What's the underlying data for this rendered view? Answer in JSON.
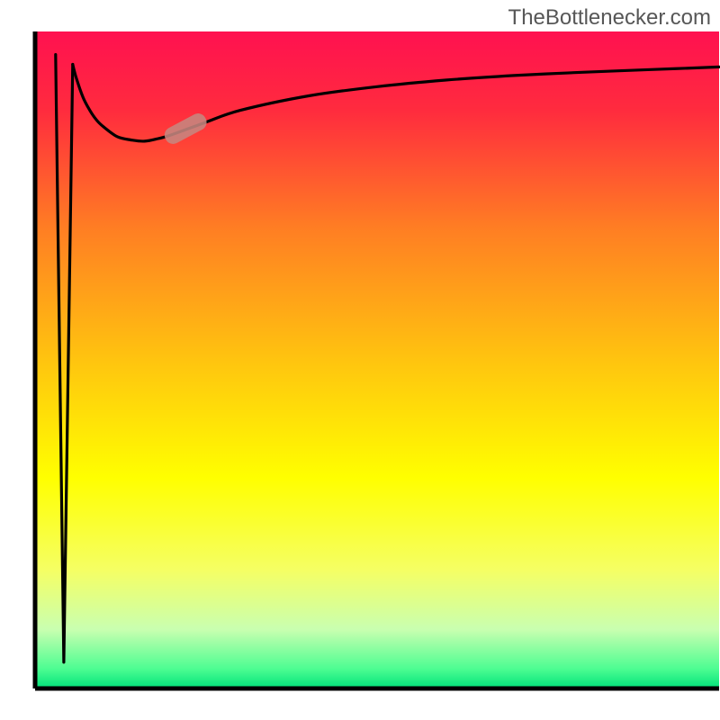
{
  "attribution": "TheBottlenecker.com",
  "chart_data": {
    "type": "line",
    "title": "",
    "xlabel": "",
    "ylabel": "",
    "xlim": [
      0,
      100
    ],
    "ylim": [
      0,
      100
    ],
    "background_gradient": {
      "stops": [
        {
          "offset": 0.0,
          "color": "#ff1150"
        },
        {
          "offset": 0.12,
          "color": "#ff2b3e"
        },
        {
          "offset": 0.3,
          "color": "#ff7e23"
        },
        {
          "offset": 0.5,
          "color": "#ffc40f"
        },
        {
          "offset": 0.68,
          "color": "#ffff00"
        },
        {
          "offset": 0.82,
          "color": "#f5ff64"
        },
        {
          "offset": 0.91,
          "color": "#c9ffb0"
        },
        {
          "offset": 0.97,
          "color": "#4dfd92"
        },
        {
          "offset": 1.0,
          "color": "#00e27a"
        }
      ]
    },
    "series": [
      {
        "name": "left-dip",
        "x": [
          3.0,
          4.2,
          5.5
        ],
        "y": [
          96.5,
          4.0,
          95.0
        ]
      },
      {
        "name": "log-curve",
        "x": [
          5.5,
          6.0,
          7.0,
          8.0,
          9.0,
          10.0,
          12.0,
          14.0,
          16.0,
          18.0,
          20.0,
          25.0,
          30.0,
          40.0,
          50.0,
          60.0,
          70.0,
          80.0,
          90.0,
          100.0
        ],
        "y": [
          95.0,
          93.0,
          90.0,
          88.0,
          86.5,
          85.5,
          84.0,
          83.5,
          83.3,
          83.7,
          84.3,
          86.2,
          88.0,
          90.2,
          91.6,
          92.6,
          93.3,
          93.8,
          94.2,
          94.6
        ]
      }
    ],
    "marker": {
      "x_center": 22.0,
      "y_center": 85.2,
      "angle_deg": 28,
      "color": "#c68680"
    },
    "axes": {
      "left_line": true,
      "bottom_line": true,
      "right_line": false,
      "top_line": false,
      "line_color": "#000000"
    }
  }
}
